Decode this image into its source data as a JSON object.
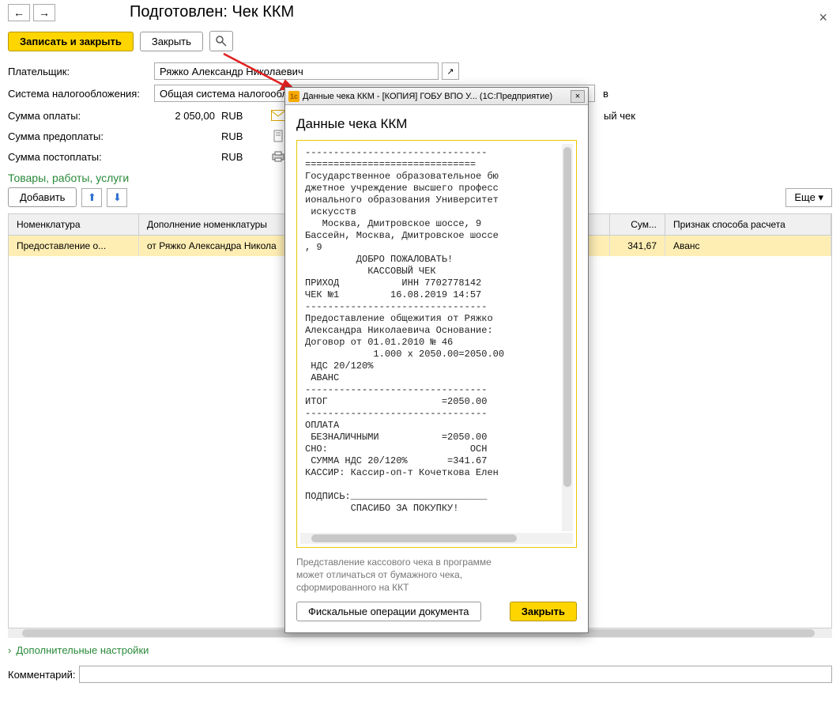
{
  "header": {
    "title": "Подготовлен: Чек ККМ"
  },
  "toolbar": {
    "save_close": "Записать и закрыть",
    "close": "Закрыть"
  },
  "fields": {
    "payer_label": "Плательщик:",
    "payer_value": "Ряжко Александр Николаевич",
    "tax_label": "Система налогообложения:",
    "tax_value": "Общая система налогооблож",
    "sum_label": "Сумма оплаты:",
    "sum_value": "2 050,00",
    "sum_cur": "RUB",
    "prepay_label": "Сумма предоплаты:",
    "prepay_value": "",
    "prepay_cur": "RUB",
    "postpay_label": "Сумма постоплаты:",
    "postpay_value": "",
    "postpay_cur": "RUB",
    "side_text_1": "в",
    "side_text_2": "ый чек"
  },
  "section": {
    "title": "Товары, работы, услуги",
    "add_btn": "Добавить",
    "more_btn": "Еще"
  },
  "table": {
    "headers": [
      "Номенклатура",
      "Дополнение номенклатуры",
      "",
      "Сум...",
      "Признак способа расчета"
    ],
    "rows": [
      {
        "nomen": "Предоставление о...",
        "dop": "от Ряжко Александра Никола",
        "sum": "341,67",
        "priznak": "Аванс"
      }
    ]
  },
  "expand": {
    "label": "Дополнительные настройки"
  },
  "comment": {
    "label": "Комментарий:",
    "value": ""
  },
  "modal": {
    "titlebar": "Данные чека ККМ - [КОПИЯ] ГОБУ ВПО У... (1С:Предприятие)",
    "header": "Данные чека ККМ",
    "note": "Представление кассового чека в программе может отличаться от бумажного чека, сформированного на ККТ",
    "fiscal_btn": "Фискальные операции документа",
    "close_btn": "Закрыть",
    "receipt": "--------------------------------\n==============================\nГосударственное образовательное бю\nджетное учреждение высшего професс\nионального образования Университет\n искусств\n   Москва, Дмитровское шоссе, 9\nБассейн, Москва, Дмитровское шоссе\n, 9\n         ДОБРО ПОЖАЛОВАТЬ!\n           КАССОВЫЙ ЧЕК\nПРИХОД           ИНН 7702778142\nЧЕК №1         16.08.2019 14:57\n--------------------------------\nПредоставление общежития от Ряжко\nАлександра Николаевича Основание:\nДоговор от 01.01.2010 № 46\n            1.000 x 2050.00=2050.00\n НДС 20/120%\n АВАНС\n--------------------------------\nИТОГ                    =2050.00\n--------------------------------\nОПЛАТА\n БЕЗНАЛИЧНЫМИ           =2050.00\nСНО:                         ОСН\n СУММА НДС 20/120%       =341.67\nКАССИР: Кассир-оп-т Кочеткова Елен\n\nПОДПИСЬ:________________________\n        СПАСИБО ЗА ПОКУПКУ!"
  }
}
